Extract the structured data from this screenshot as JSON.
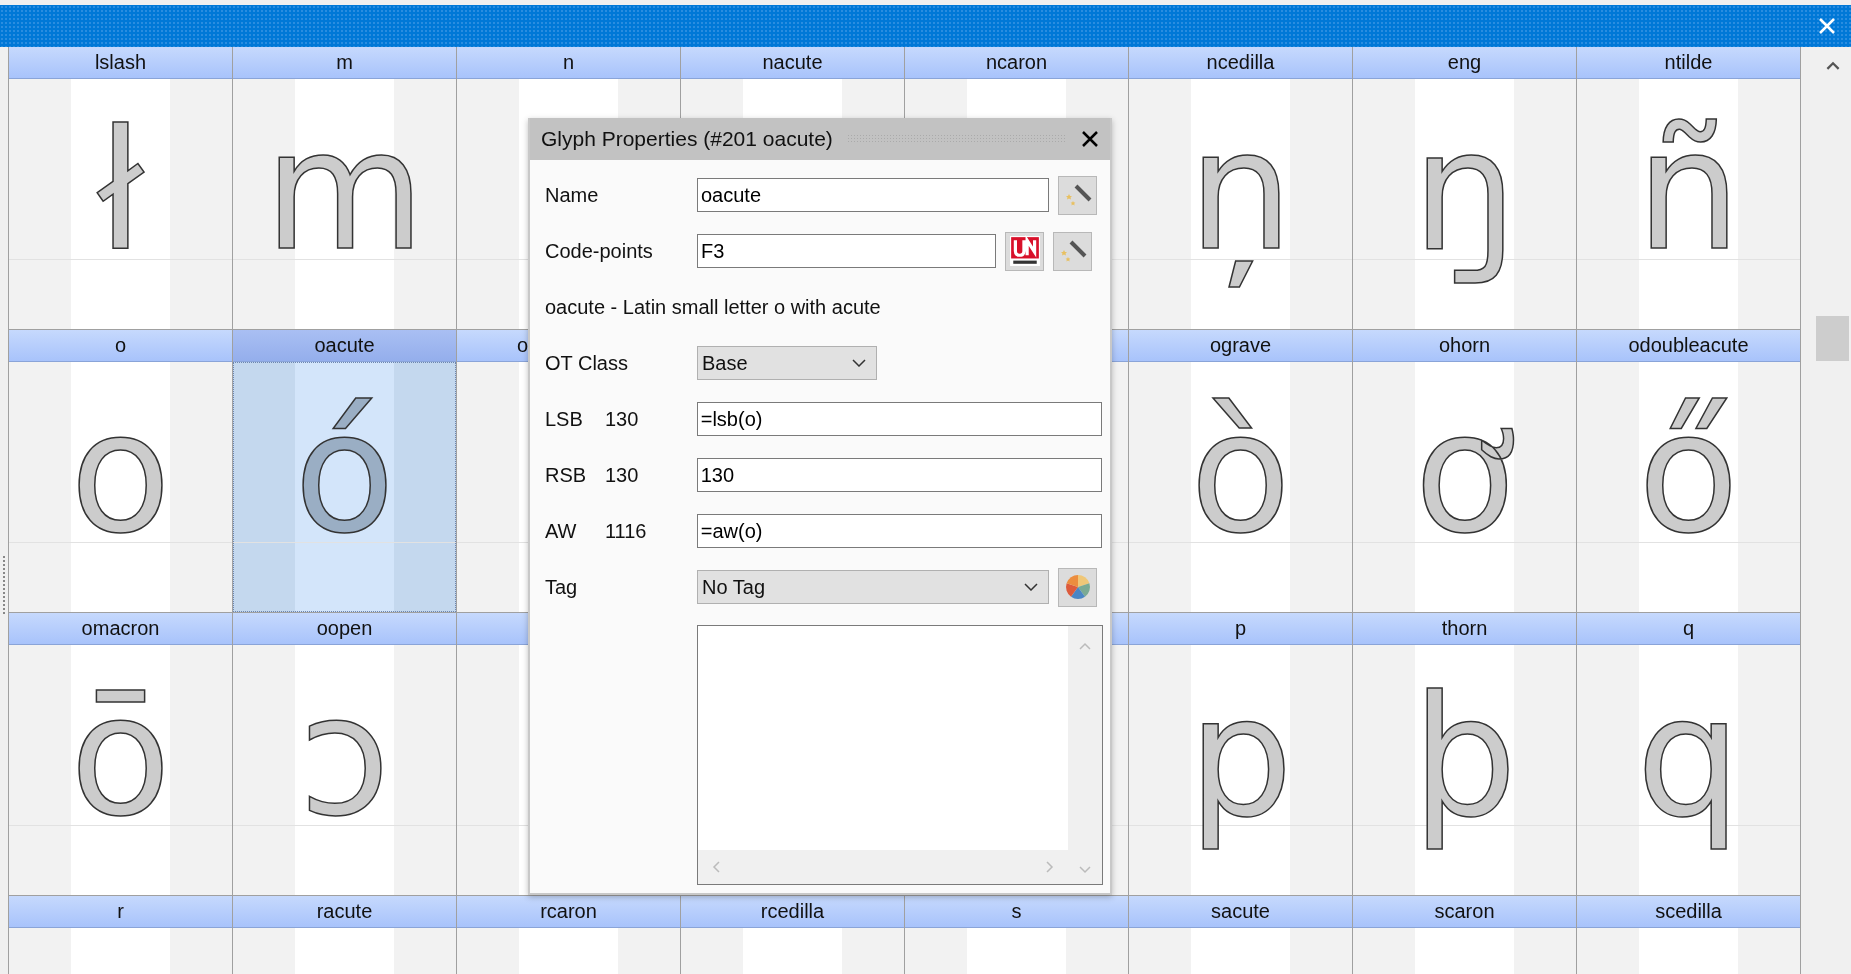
{
  "rows": [
    {
      "cells": [
        {
          "name": "lslash",
          "glyph": "ł",
          "selected": false
        },
        {
          "name": "m",
          "glyph": "m",
          "selected": false
        },
        {
          "name": "n",
          "selected": false
        },
        {
          "name": "nacute",
          "selected": false
        },
        {
          "name": "ncaron",
          "selected": false
        },
        {
          "name": "ncedilla",
          "glyph": "ņ",
          "selected": false
        },
        {
          "name": "eng",
          "glyph": "ŋ",
          "selected": false
        },
        {
          "name": "ntilde",
          "glyph": "ñ",
          "selected": false
        }
      ]
    },
    {
      "cells": [
        {
          "name": "o",
          "glyph": "o",
          "selected": false
        },
        {
          "name": "oacute",
          "glyph": "ó",
          "selected": true
        },
        {
          "name": "o",
          "partial": true,
          "selected": false
        },
        {},
        {
          "selected": false
        },
        {
          "name": "ograve",
          "glyph": "ò",
          "selected": false
        },
        {
          "name": "ohorn",
          "glyph": "ơ",
          "selected": false
        },
        {
          "name": "odoubleacute",
          "glyph": "ő",
          "selected": false
        }
      ]
    },
    {
      "cells": [
        {
          "name": "omacron",
          "glyph": "ō",
          "selected": false
        },
        {
          "name": "oopen",
          "glyph": "ɔ",
          "selected": false
        },
        {
          "selected": false
        },
        {},
        {
          "selected": false
        },
        {
          "name": "p",
          "glyph": "p",
          "selected": false
        },
        {
          "name": "thorn",
          "glyph": "þ",
          "selected": false
        },
        {
          "name": "q",
          "glyph": "q",
          "selected": false
        }
      ]
    },
    {
      "cells": [
        {
          "name": "r",
          "selected": false
        },
        {
          "name": "racute",
          "selected": false
        },
        {
          "name": "rcaron",
          "selected": false
        },
        {
          "name": "rcedilla",
          "selected": false
        },
        {
          "name": "s",
          "selected": false
        },
        {
          "name": "sacute",
          "selected": false
        },
        {
          "name": "scaron",
          "selected": false
        },
        {
          "name": "scedilla",
          "selected": false
        }
      ]
    }
  ],
  "dialog": {
    "title": "Glyph Properties (#201 oacute)",
    "name_label": "Name",
    "name_value": "oacute",
    "codepoints_label": "Code-points",
    "codepoints_value": "F3",
    "description": "oacute - Latin small letter o with acute",
    "ot_class_label": "OT Class",
    "ot_class_value": "Base",
    "metrics": [
      {
        "label": "LSB",
        "value": "130",
        "formula": "=lsb(o)"
      },
      {
        "label": "RSB",
        "value": "130",
        "formula": "130"
      },
      {
        "label": "AW",
        "value": "1116",
        "formula": "=aw(o)"
      }
    ],
    "tag_label": "Tag",
    "tag_value": "No Tag"
  }
}
